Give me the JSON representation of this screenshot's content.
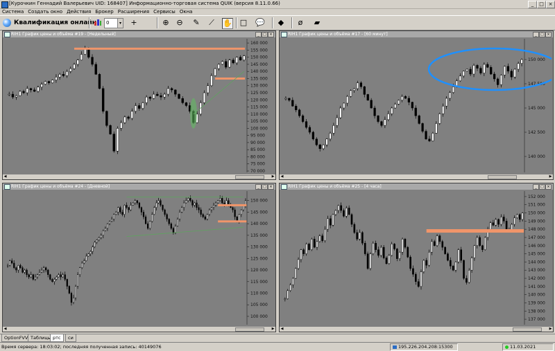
{
  "window": {
    "title": "[Курочкин Геннадий Валерьевич UID: 168407] Информационно-торговая система QUIK (версия 8.11.0.66)",
    "controls": [
      "_",
      "□",
      "×"
    ]
  },
  "menu": [
    "Система",
    "Создать окно",
    "Действия",
    "Брокер",
    "Расширения",
    "Сервисы",
    "Окна"
  ],
  "toolbar": {
    "qualification_label": "Квалификация онлайн",
    "num_value": "0",
    "dropdown_glyph": "▾",
    "tools": [
      {
        "name": "crosshair-icon",
        "glyph": "+"
      },
      {
        "name": "zoom-in-icon",
        "glyph": "⊕"
      },
      {
        "name": "zoom-out-icon",
        "glyph": "⊖"
      },
      {
        "name": "pencil-icon",
        "glyph": "✎"
      },
      {
        "name": "ruler-icon",
        "glyph": "⟋"
      },
      {
        "name": "hand-icon",
        "glyph": "✋"
      },
      {
        "name": "rectangle-icon",
        "glyph": "□"
      },
      {
        "name": "callout-icon",
        "glyph": "💬"
      },
      {
        "name": "paint-icon",
        "glyph": "◆"
      },
      {
        "name": "hide-icon",
        "glyph": "ø"
      },
      {
        "name": "eraser-icon",
        "glyph": "▰"
      }
    ]
  },
  "colors": {
    "bg": "#808080",
    "up": "#ffffff",
    "down": "#000000",
    "level": "#f0956a",
    "trend": "#5fa35f",
    "ellipse": "#1e90ff"
  },
  "panels": [
    {
      "title": "RIH1 График цены и объёма #19 - [Недельный]",
      "chart_data": {
        "type": "candlestick",
        "ylim": [
          70000,
          162000
        ],
        "yticks": [
          "160 000",
          "155 000",
          "150 000",
          "145 000",
          "140 000",
          "135 000",
          "130 000",
          "125 000",
          "120 000",
          "115 000",
          "110 000",
          "105 000",
          "100 000",
          "95 000",
          "90 000",
          "85 000",
          "80 000",
          "75 000",
          "70 000"
        ],
        "candles": [
          124000,
          122000,
          123000,
          126000,
          125000,
          128000,
          127000,
          126000,
          129000,
          131000,
          133000,
          132000,
          134000,
          136000,
          138000,
          137000,
          140000,
          142000,
          145000,
          148000,
          152000,
          156000,
          150000,
          145000,
          138000,
          128000,
          112000,
          102000,
          96000,
          84000,
          100000,
          104000,
          108000,
          107000,
          112000,
          116000,
          114000,
          118000,
          122000,
          121000,
          124000,
          123000,
          122000,
          124000,
          128000,
          127000,
          124000,
          121000,
          118000,
          116000,
          112000,
          104000,
          110000,
          118000,
          125000,
          130000,
          137000,
          142000,
          145000,
          147000,
          143000,
          148000,
          146000,
          150000,
          148000,
          151000
        ],
        "levels": [
          156000,
          135000
        ],
        "trend": [
          [
            52,
            110000
          ],
          [
            66,
            140000
          ]
        ]
      }
    },
    {
      "title": "RIH1 График цены и объёма #17 - [60 минут]",
      "chart_data": {
        "type": "candlestick",
        "ylim": [
          138500,
          152000
        ],
        "yticks": [
          "150 000",
          "147 500",
          "145 000",
          "142 500",
          "140 000"
        ],
        "candles": [
          146000,
          145800,
          145200,
          144800,
          144200,
          143600,
          143000,
          142500,
          141800,
          141200,
          140800,
          141200,
          141800,
          142400,
          143200,
          144000,
          145000,
          145500,
          146200,
          146800,
          147000,
          147600,
          147200,
          146400,
          145800,
          145000,
          144200,
          143600,
          143200,
          143800,
          144400,
          145000,
          145400,
          145800,
          146200,
          146000,
          145600,
          145000,
          144200,
          143400,
          142600,
          141800,
          141600,
          142400,
          143400,
          144400,
          145200,
          146000,
          146600,
          147200,
          147800,
          148300,
          148800,
          149000,
          148500,
          149400,
          149100,
          148600,
          149500,
          149200,
          148500,
          148000,
          147400,
          148400,
          149300,
          148800,
          148200,
          149000,
          149600,
          150000
        ],
        "ellipse": true,
        "levels": []
      }
    },
    {
      "title": "RIH1 График цены и объёма #24 - [Дневной]",
      "chart_data": {
        "type": "candlestick",
        "ylim": [
          97000,
          153500
        ],
        "yticks": [
          "150 000",
          "145 000",
          "140 000",
          "135 000",
          "130 000",
          "125 000",
          "120 000",
          "115 000",
          "110 000",
          "105 000",
          "100 000"
        ],
        "candles": [
          122000,
          124000,
          123000,
          121000,
          120000,
          122000,
          121000,
          119000,
          120000,
          118000,
          117000,
          118000,
          116000,
          117000,
          118000,
          119000,
          120000,
          121000,
          120000,
          118000,
          116000,
          115000,
          116000,
          117000,
          118000,
          117000,
          118000,
          116000,
          113000,
          110000,
          106000,
          108000,
          113000,
          118000,
          121000,
          123000,
          124000,
          126000,
          127000,
          128000,
          130000,
          132000,
          133000,
          134000,
          135000,
          137000,
          138000,
          140000,
          141000,
          142000,
          144000,
          145000,
          147000,
          145000,
          144000,
          148000,
          147000,
          146000,
          148000,
          149000,
          150000,
          149000,
          147000,
          145000,
          143000,
          140000,
          138000,
          141000,
          144000,
          147000,
          149000,
          150000,
          148000,
          146000,
          144000,
          142000,
          140000,
          138000,
          136000,
          139000,
          142000,
          145000,
          147000,
          149000,
          150000,
          151000,
          150000,
          148000,
          149000,
          147000,
          146000,
          144000,
          143000,
          142000,
          144000,
          146000,
          147000,
          148000,
          149000,
          150000,
          151000,
          149000,
          148000,
          150000,
          148000,
          147000,
          146000,
          143000,
          141000,
          144000,
          146000,
          148000,
          150000
        ],
        "levels": [
          148000,
          141000
        ],
        "trend_lines": [
          [
            [
              57,
              134500
            ],
            [
              112,
              138500
            ]
          ],
          [
            [
              57,
              151500
            ],
            [
              112,
              151500
            ]
          ]
        ]
      }
    },
    {
      "title": "RIH1 График цены и объёма #25 - [4 часа]",
      "chart_data": {
        "type": "candlestick",
        "ylim": [
          136500,
          152500
        ],
        "yticks": [
          "152 000",
          "151 000",
          "150 000",
          "149 000",
          "148 000",
          "147 000",
          "146 000",
          "145 000",
          "144 000",
          "143 000",
          "142 000",
          "141 000",
          "140 000",
          "139 000",
          "138 000",
          "137 000"
        ],
        "candles": [
          139500,
          140500,
          141200,
          142000,
          143200,
          144300,
          145500,
          145000,
          146200,
          145500,
          146800,
          145800,
          146500,
          147200,
          146600,
          148000,
          149300,
          148500,
          149800,
          150300,
          150900,
          150300,
          149600,
          150600,
          149800,
          148600,
          147600,
          146800,
          147600,
          146300,
          145000,
          143200,
          145000,
          146300,
          145500,
          144800,
          145800,
          144500,
          143800,
          144800,
          146200,
          145600,
          144400,
          145200,
          146800,
          145800,
          144600,
          143200,
          142500,
          141600,
          141000,
          142800,
          144200,
          143600,
          145200,
          146500,
          146000,
          147200,
          146500,
          145800,
          145000,
          144200,
          143500,
          143000,
          144000,
          145500,
          144200,
          142000,
          141500,
          143000,
          144500,
          146000,
          147000,
          146000,
          145500,
          147000,
          148000,
          148800,
          148500,
          149200,
          148600,
          149500,
          149000,
          148000,
          147800,
          148600,
          149400,
          149800,
          149200,
          150000
        ],
        "levels": [
          147800
        ],
        "trend": []
      }
    }
  ],
  "tabs": [
    "OptionFVV",
    "Таблицы",
    "ртс",
    "си"
  ],
  "active_tab": 2,
  "status": {
    "server_time": "Время сервера: 18:03:02; последняя полученная запись: 40149076",
    "ip": "195.226.204.208:15300",
    "date": "11.03.2021"
  }
}
